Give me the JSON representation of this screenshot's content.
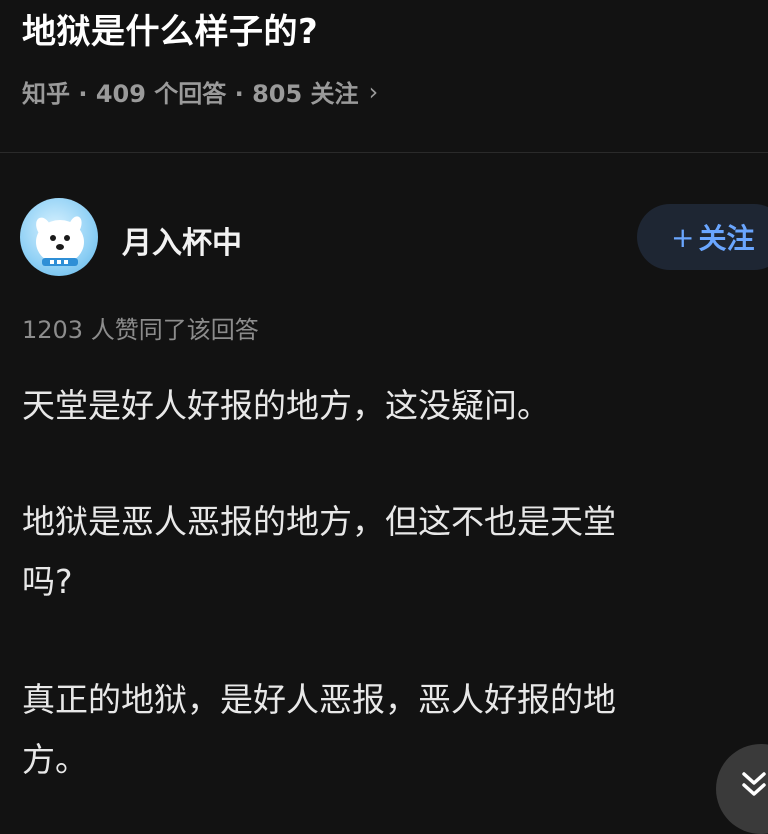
{
  "question": {
    "title": "地狱是什么样子的?",
    "meta": "知乎 · 409 个回答 · 805 关注",
    "chevron": "›"
  },
  "author": {
    "name": "月入杯中",
    "avatar_icon": "dog-avatar-icon"
  },
  "follow_button": {
    "plus": "+",
    "label": "关注"
  },
  "answer": {
    "upvotes": "1203 人赞同了该回答",
    "paragraph1_line1": "天堂是好人好报的地方，这没疑问。",
    "paragraph2_line1": "地狱是恶人恶报的地方，但这不也是天堂",
    "paragraph2_line2": "吗?",
    "paragraph3_line1": "真正的地狱，是好人恶报，恶人好报的地",
    "paragraph3_line2": "方。"
  },
  "scroll_button": {
    "icon": "double-chevron-down-icon"
  },
  "colors": {
    "background": "#121212",
    "accent": "#6aa6ff",
    "follow_bg": "#1e2633"
  }
}
